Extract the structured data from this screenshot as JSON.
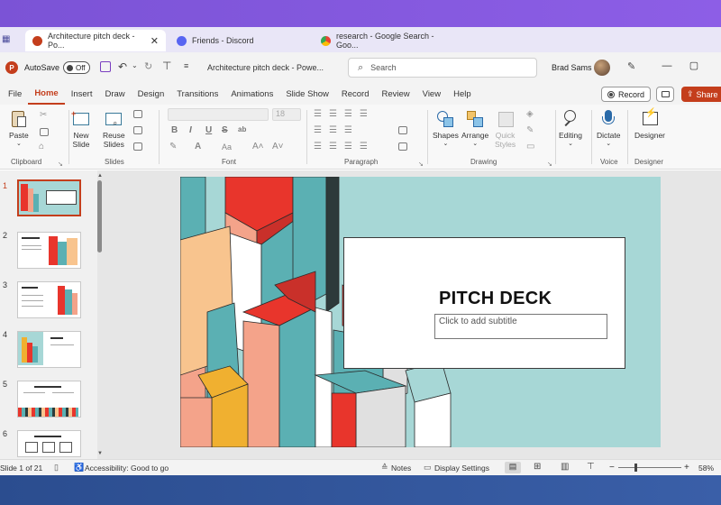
{
  "colors": {
    "accent": "#c43e1c",
    "slide_bg": "#a7d7d6",
    "top_bar": "#7b53d6"
  },
  "browser": {
    "tabs": [
      {
        "label": "Architecture pitch deck - Po...",
        "icon": "powerpoint-icon",
        "active": true
      },
      {
        "label": "Friends - Discord",
        "icon": "discord-icon",
        "active": false
      },
      {
        "label": "research - Google Search - Goo...",
        "icon": "chrome-icon",
        "active": false
      }
    ]
  },
  "titlebar": {
    "autosave_label": "AutoSave",
    "autosave_state": "Off",
    "doc_title": "Architecture pitch deck  -  Powe...",
    "search_placeholder": "Search",
    "user_name": "Brad Sams"
  },
  "ribbon": {
    "tabs": [
      "File",
      "Home",
      "Insert",
      "Draw",
      "Design",
      "Transitions",
      "Animations",
      "Slide Show",
      "Record",
      "Review",
      "View",
      "Help"
    ],
    "active_tab": "Home",
    "record_label": "Record",
    "share_label": "Share",
    "font_size": "18",
    "groups": {
      "clipboard": {
        "label": "Clipboard",
        "paste": "Paste"
      },
      "slides": {
        "label": "Slides",
        "new_slide_1": "New",
        "new_slide_2": "Slide",
        "reuse_1": "Reuse",
        "reuse_2": "Slides"
      },
      "font": {
        "label": "Font"
      },
      "paragraph": {
        "label": "Paragraph"
      },
      "drawing": {
        "label": "Drawing",
        "shapes": "Shapes",
        "arrange": "Arrange",
        "quick_styles_1": "Quick",
        "quick_styles_2": "Styles"
      },
      "editing": {
        "label": "Editing"
      },
      "voice": {
        "label": "Voice",
        "dictate": "Dictate"
      },
      "designer": {
        "label": "Designer",
        "designer": "Designer"
      }
    },
    "font_buttons": [
      "B",
      "I",
      "U",
      "S",
      "ab"
    ]
  },
  "thumbnails": [
    {
      "num": "1",
      "active": true
    },
    {
      "num": "2",
      "active": false
    },
    {
      "num": "3",
      "active": false
    },
    {
      "num": "4",
      "active": false
    },
    {
      "num": "5",
      "active": false
    },
    {
      "num": "6",
      "active": false
    }
  ],
  "slide": {
    "title": "PITCH DECK",
    "subtitle_placeholder": "Click to add subtitle"
  },
  "statusbar": {
    "slide_count": "Slide 1 of 21",
    "accessibility": "Accessibility: Good to go",
    "notes": "Notes",
    "display_settings": "Display Settings",
    "zoom": "58%",
    "zoom_minus": "−",
    "zoom_plus": "+"
  }
}
